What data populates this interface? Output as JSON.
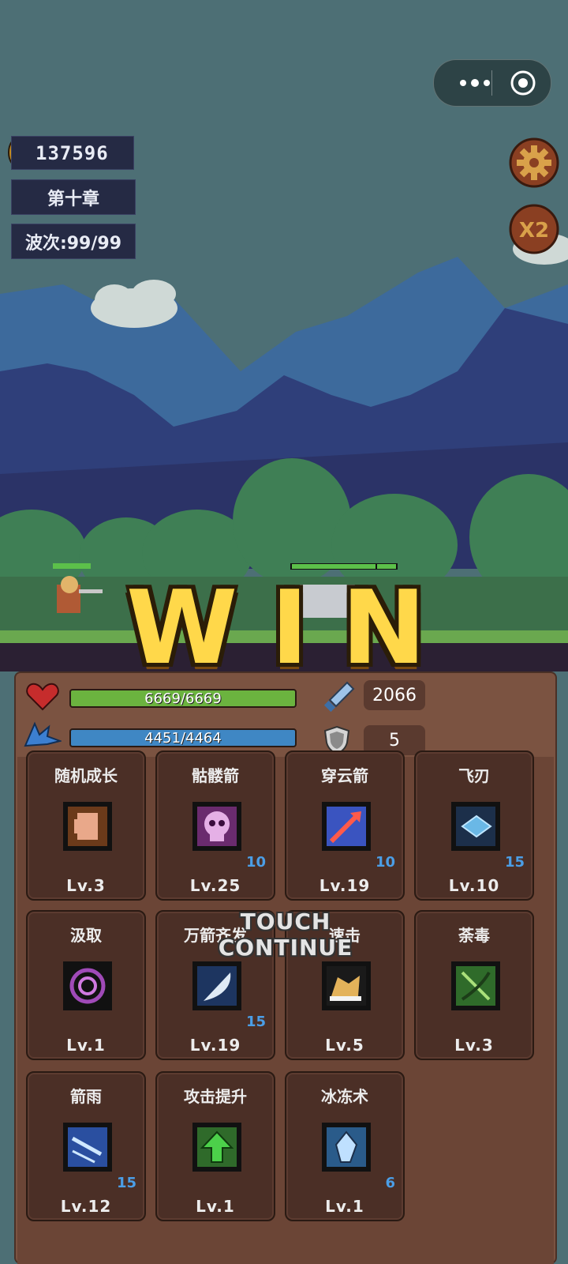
{
  "top": {
    "coins": "137596",
    "chapter": "第十章",
    "wave": "波次:99/99",
    "x2_label": "X2"
  },
  "win_letters": [
    "W",
    "I",
    "N"
  ],
  "stats": {
    "hp": "6669/6669",
    "mp": "4451/4464",
    "attack": "2066",
    "defense": "5"
  },
  "skills": [
    {
      "name": "随机成长",
      "level": "Lv.3",
      "count": "",
      "icon": "fist-icon"
    },
    {
      "name": "骷髅箭",
      "level": "Lv.25",
      "count": "10",
      "icon": "skull-icon"
    },
    {
      "name": "穿云箭",
      "level": "Lv.19",
      "count": "10",
      "icon": "arrow-icon"
    },
    {
      "name": "飞刃",
      "level": "Lv.10",
      "count": "15",
      "icon": "blade-icon"
    },
    {
      "name": "汲取",
      "level": "Lv.1",
      "count": "",
      "icon": "vortex-icon"
    },
    {
      "name": "万箭齐发",
      "level": "Lv.19",
      "count": "15",
      "icon": "feather-icon"
    },
    {
      "name": "速击",
      "level": "Lv.5",
      "count": "",
      "icon": "speed-boot-icon"
    },
    {
      "name": "荼毒",
      "level": "Lv.3",
      "count": "",
      "icon": "poison-bow-icon"
    },
    {
      "name": "箭雨",
      "level": "Lv.12",
      "count": "15",
      "icon": "arrow-rain-icon"
    },
    {
      "name": "攻击提升",
      "level": "Lv.1",
      "count": "",
      "icon": "up-arrow-icon"
    },
    {
      "name": "冰冻术",
      "level": "Lv.1",
      "count": "6",
      "icon": "ice-crystal-icon"
    }
  ],
  "touch_continue": "TOUCH CONTINUE",
  "colors": {
    "sky": "#4d6f75",
    "panel": "#7b5341",
    "card": "#4b2f26",
    "hp": "#6bb33f",
    "mp": "#3f87c4",
    "win": "#ffd84a",
    "count": "#4b9ee6"
  }
}
